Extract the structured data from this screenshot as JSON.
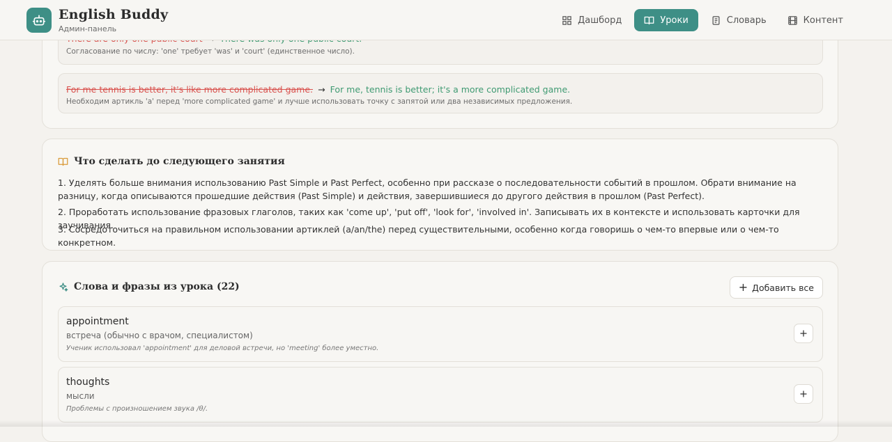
{
  "header": {
    "brand_title": "English Buddy",
    "brand_subtitle": "Админ-панель",
    "nav": [
      {
        "label": "Дашборд",
        "icon": "dashboard-icon",
        "active": false
      },
      {
        "label": "Уроки",
        "icon": "book-icon",
        "active": true
      },
      {
        "label": "Словарь",
        "icon": "notebook-icon",
        "active": false
      },
      {
        "label": "Контент",
        "icon": "film-icon",
        "active": false
      }
    ]
  },
  "corrections": [
    {
      "wrong": "There are only one public court",
      "right": "There was only one public court.",
      "explanation": "Согласование по числу: 'one' требует 'was' и 'court' (единственное число)."
    },
    {
      "wrong": "For me tennis is better, it's like more complicated game.",
      "right": "For me, tennis is better; it's a more complicated game.",
      "explanation": "Необходим артикль 'a' перед 'more complicated game' и лучше использовать точку с запятой или два независимых предложения."
    }
  ],
  "homework": {
    "title": "Что сделать до следующего занятия",
    "items": [
      "1. Уделять больше внимания использованию Past Simple и Past Perfect, особенно при рассказе о последовательности событий в прошлом. Обрати внимание на разницу, когда описываются прошедшие действия (Past Simple) и действия, завершившиеся до другого действия в прошлом (Past Perfect).",
      "2. Проработать использование фразовых глаголов, таких как 'come up', 'put off', 'look for', 'involved in'. Записывать их в контексте и использовать карточки для заучивания.",
      "3. Сосредоточиться на правильном использовании артиклей (a/an/the) перед существительными, особенно когда говоришь о чем-то впервые или о чем-то конкретном."
    ]
  },
  "vocabulary": {
    "title": "Слова и фразы из урока (22)",
    "add_all_label": "Добавить все",
    "items": [
      {
        "word": "appointment",
        "translation": "встреча (обычно с врачом, специалистом)",
        "note": "Ученик использовал 'appointment' для деловой встречи, но 'meeting' более уместно."
      },
      {
        "word": "thoughts",
        "translation": "мысли",
        "note": "Проблемы с произношением звука /θ/."
      }
    ]
  },
  "colors": {
    "accent": "#3e8f86",
    "wrong": "#d9534f",
    "right": "#3f9a72",
    "homework_icon": "#d99a3a",
    "vocab_icon": "#3e8f86"
  }
}
